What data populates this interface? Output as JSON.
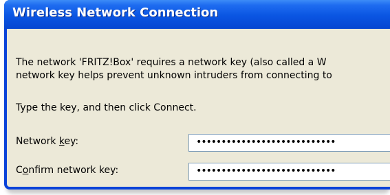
{
  "window": {
    "title": "Wireless Network Connection"
  },
  "body": {
    "message_line1": "The network 'FRITZ!Box' requires a network key (also called a W",
    "message_line2": "network key helps prevent unknown intruders from connecting to",
    "instruction": "Type the key, and then click Connect."
  },
  "form": {
    "network_key": {
      "label_pre": "Network ",
      "label_access": "k",
      "label_post": "ey:",
      "value": "••••••••••••••••••••••••••••"
    },
    "confirm_key": {
      "label_pre": "C",
      "label_access": "o",
      "label_post": "nfirm network key:",
      "value": "••••••••••••••••••••••••••••"
    }
  }
}
